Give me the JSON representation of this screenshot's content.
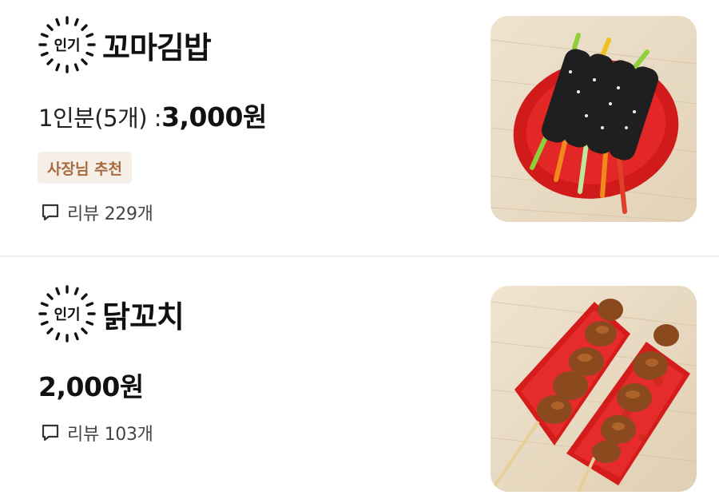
{
  "menu_items": [
    {
      "badge": "인기",
      "name": "꼬마김밥",
      "portion": "1인분(5개) : ",
      "price": "3,000원",
      "owner_tag": "사장님 추천",
      "review_label": "리뷰 229개",
      "photo_icon": "gimbap-photo"
    },
    {
      "badge": "인기",
      "name": "닭꼬치",
      "price": "2,000원",
      "review_label": "리뷰 103개",
      "photo_icon": "chicken-skewer-photo"
    }
  ],
  "colors": {
    "owner_tag_bg": "#f6efe8",
    "owner_tag_text": "#a86a3f",
    "divider": "#efefef"
  }
}
